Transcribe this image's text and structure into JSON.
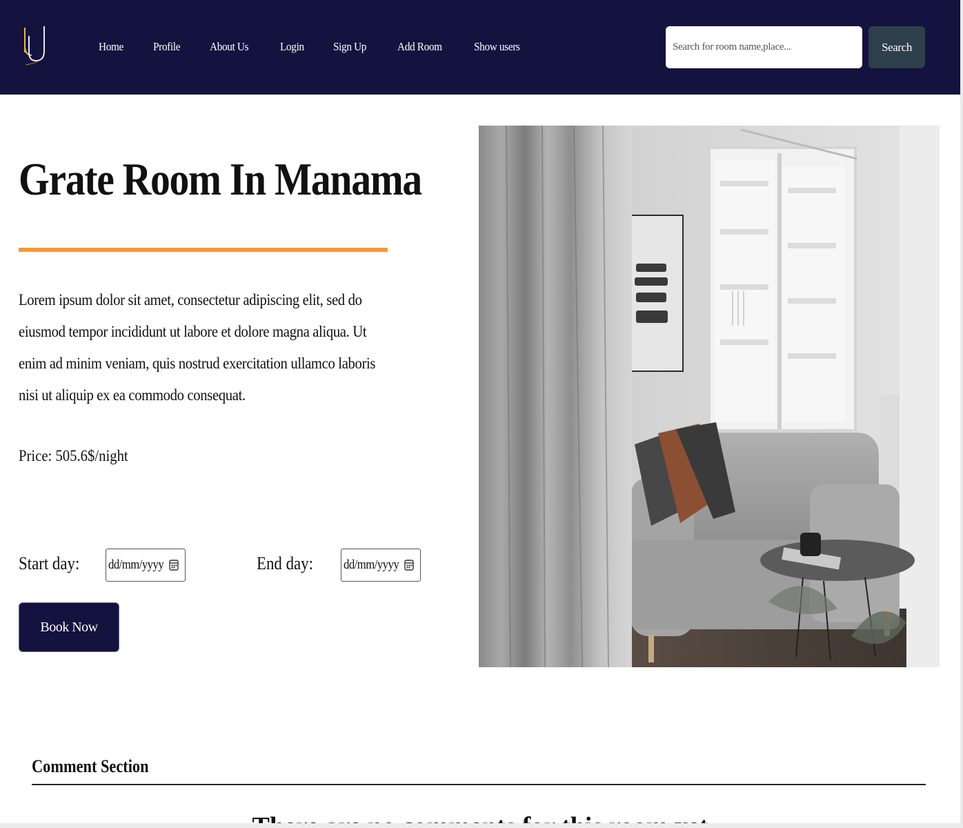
{
  "navbar": {
    "links": [
      "Home",
      "Profile",
      "About Us",
      "Login",
      "Sign Up",
      "Add Room",
      "Show users"
    ],
    "search_placeholder": "Search for room name,place...",
    "search_button": "Search",
    "bg_color": "#14123f"
  },
  "room": {
    "title": "Grate Room In Manama",
    "description": "Lorem ipsum dolor sit amet, consectetur adipiscing elit, sed do eiusmod tempor incididunt ut labore et dolore magna aliqua. Ut enim ad minim veniam, quis nostrud exercitation ullamco laboris nisi ut aliquip ex ea commodo consequat.",
    "price": "Price: 505.6$/night",
    "divider_color": "#f5973a"
  },
  "booking": {
    "start_label": "Start day:",
    "end_label": "End day:",
    "date_placeholder": "dd/mm/yyyy",
    "book_button": "Book Now"
  },
  "comments": {
    "heading": "Comment Section",
    "empty_text": "There are no comments for this room yet"
  }
}
